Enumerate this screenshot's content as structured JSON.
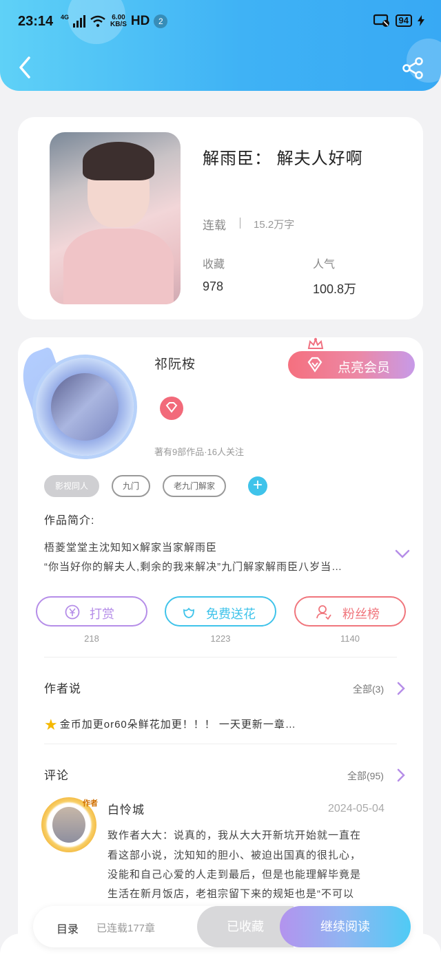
{
  "status_bar": {
    "time": "23:14",
    "network": "4G",
    "speed_value": "6.00",
    "speed_unit": "KB/S",
    "hd": "HD",
    "notification_count": "2",
    "battery": "94"
  },
  "header": {
    "back_icon": "chevron-left-icon",
    "share_icon": "share-icon",
    "background_color": "#3fb2f5"
  },
  "book": {
    "title": "解雨臣：  解夫人好啊",
    "status": "连载",
    "word_count": "15.2万字",
    "stats": [
      {
        "label": "收藏",
        "value": "978"
      },
      {
        "label": "人气",
        "value": "100.8万"
      }
    ]
  },
  "author": {
    "name": "祁阮桉",
    "meta": "著有9部作品·16人关注",
    "vip_button": "点亮会员",
    "tags": [
      "影视同人",
      "九门",
      "老九门解家"
    ],
    "add_tag_icon": "plus-icon"
  },
  "intro": {
    "label": "作品简介:",
    "lines": [
      "梧菱堂堂主沈知知X解家当家解雨臣",
      "“你当好你的解夫人,剩余的我来解决”九门解家解雨臣八岁当…"
    ]
  },
  "actions": [
    {
      "label": "打赏",
      "count": "218",
      "icon": "yen-icon",
      "color": "#b58de8"
    },
    {
      "label": "免费送花",
      "count": "1223",
      "icon": "flower-icon",
      "color": "#3fc3ea"
    },
    {
      "label": "粉丝榜",
      "count": "1140",
      "icon": "user-rank-icon",
      "color": "#f0757c"
    }
  ],
  "author_says": {
    "title": "作者说",
    "more": "全部(3)",
    "note": "金币加更or60朵鲜花加更！！！  一天更新一章…"
  },
  "comments": {
    "title": "评论",
    "more": "全部(95)",
    "items": [
      {
        "badge": "作者",
        "name": "白怜城",
        "date": "2024-05-04",
        "lines": [
          "致作者大大：说真的，我从大大开新坑开始就一直在",
          "看这部小说，沈知知的胆小、被迫出国真的很扎心，",
          "没能和自己心爱的人走到最后，但是也能理解毕竟是",
          "生活在新月饭店，老祖宗留下来的规矩也是“不可以"
        ]
      }
    ]
  },
  "bottom_bar": {
    "toc": "目录",
    "chapters": "已连载177章",
    "favorite": "已收藏",
    "continue": "继续阅读"
  }
}
